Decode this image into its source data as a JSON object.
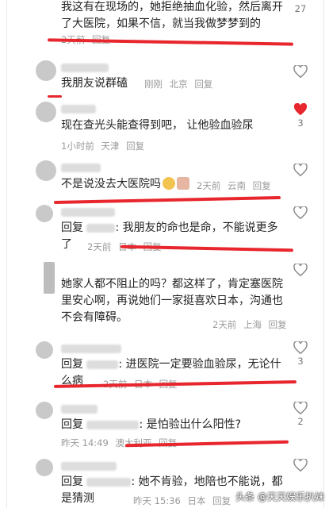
{
  "comments": [
    {
      "text": "我这有在现场的，她拒绝抽血化验，然后离开了大医院，如果不信，就当我做梦梦到的",
      "meta": [
        "2天前",
        "回复"
      ],
      "likes": "27",
      "liked": false
    },
    {
      "text": "我朋友说群磕",
      "meta": [
        "刚刚",
        "北京",
        "回复"
      ],
      "likes": "",
      "liked": false
    },
    {
      "text": "现在查光头能查得到吧， 让他验血验尿",
      "meta": [
        "1小时前",
        "天津",
        "回复"
      ],
      "likes": "3",
      "liked": true
    },
    {
      "text": "不是说没去大医院吗",
      "meta": [
        "2天前",
        "云南",
        "回复"
      ],
      "likes": "",
      "liked": false
    },
    {
      "reply_prefix": "回复",
      "text": ": 我朋友的命也是命，不能说更多了",
      "meta": [
        "2天前",
        "日本",
        "回复"
      ],
      "likes": "",
      "liked": false
    },
    {
      "text": "她家人都不阻止的吗？都这样了，肯定塞医院里安心啊，再说她们一家挺喜欢日本，沟通也不会有障碍。",
      "meta": [
        "2天前",
        "上海",
        "回复"
      ],
      "likes": "",
      "liked": false
    },
    {
      "reply_prefix": "回复",
      "text": ": 进医院一定要验血验尿，无论什么病",
      "meta": [
        "2天前",
        "日本",
        "回复"
      ],
      "likes": "3",
      "liked": false
    },
    {
      "reply_prefix": "回复",
      "text": ": 是怕验出什么阳性?",
      "meta": [
        "昨天 14:49",
        "澳大利亚",
        "回复"
      ],
      "likes": "2",
      "liked": false
    },
    {
      "reply_prefix": "回复",
      "text": ": 她不肯验，地陪也不能说，都是猜测",
      "meta": [
        "昨天 15:36",
        "日本",
        "回复"
      ],
      "likes": "",
      "liked": false
    }
  ],
  "watermark": "头条 @天天娱乐扒妹",
  "colors": {
    "accent_red": "#e8262d",
    "heart_liked": "#e8262d",
    "meta_gray": "#9a9a9a"
  }
}
